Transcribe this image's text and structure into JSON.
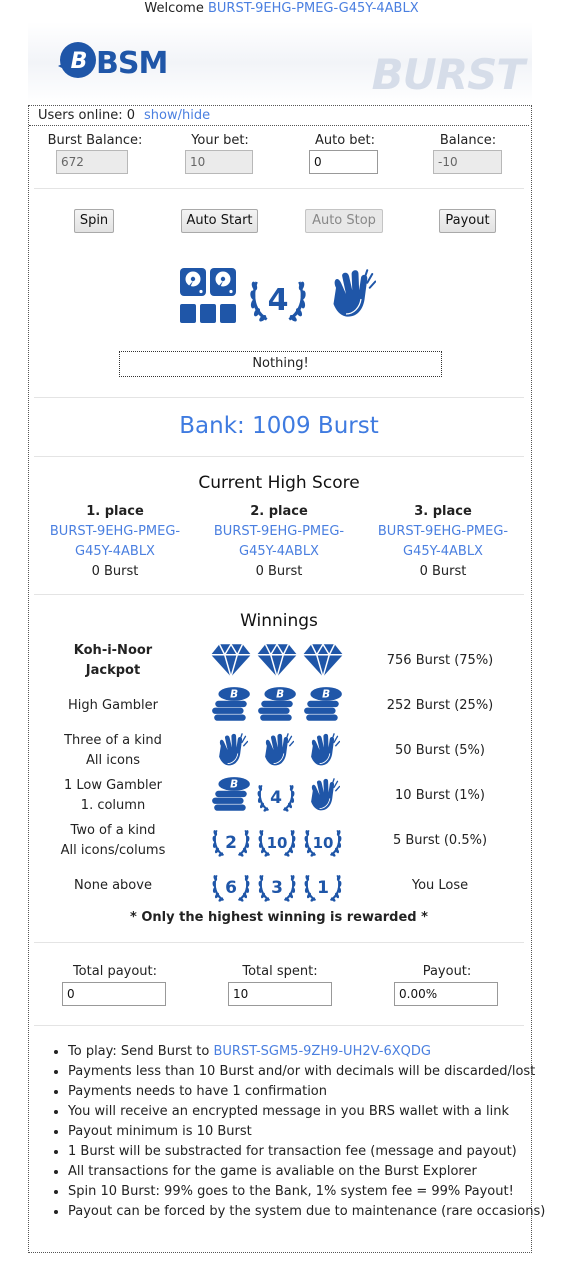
{
  "welcome": {
    "prefix": "Welcome",
    "account": "BURST-9EHG-PMEG-G45Y-4ABLX"
  },
  "header": {
    "logo_text": "BSM",
    "brand_text": "BURST"
  },
  "online": {
    "label": "Users online: 0",
    "toggle": "show/hide"
  },
  "fields": {
    "balance_label": "Burst Balance:",
    "balance_value": "672",
    "bet_label": "Your bet:",
    "bet_value": "10",
    "auto_label": "Auto bet:",
    "auto_value": "0",
    "net_label": "Balance:",
    "net_value": "-10"
  },
  "buttons": {
    "spin": "Spin",
    "auto_start": "Auto Start",
    "auto_stop": "Auto Stop",
    "payout": "Payout"
  },
  "reels": {
    "slot1": "hard-drive-icon",
    "slot2": "number-4-wreath-icon",
    "slot3": "clapping-hands-icon",
    "slot2_number": "4"
  },
  "result": "Nothing!",
  "bank": "Bank: 1009 Burst",
  "highscore": {
    "title": "Current High Score",
    "places": [
      {
        "place": "1. place",
        "acc1": "BURST-9EHG-PMEG-",
        "acc2": "G45Y-4ABLX",
        "amount": "0 Burst"
      },
      {
        "place": "2. place",
        "acc1": "BURST-9EHG-PMEG-",
        "acc2": "G45Y-4ABLX",
        "amount": "0 Burst"
      },
      {
        "place": "3. place",
        "acc1": "BURST-9EHG-PMEG-",
        "acc2": "G45Y-4ABLX",
        "amount": "0 Burst"
      }
    ]
  },
  "winnings": {
    "title": "Winnings",
    "rows": [
      {
        "l1": "Koh-i-Noor",
        "l2": "Jackpot",
        "value": "756 Burst (75%)",
        "icons": [
          "diamond-icon",
          "diamond-icon",
          "diamond-icon"
        ]
      },
      {
        "l1": "High Gambler",
        "l2": "",
        "value": "252 Burst (25%)",
        "icons": [
          "coin-stack-icon",
          "coin-stack-icon",
          "coin-stack-icon"
        ]
      },
      {
        "l1": "Three of a kind",
        "l2": "All icons",
        "value": "50 Burst (5%)",
        "icons": [
          "clapping-hands-icon",
          "clapping-hands-icon",
          "clapping-hands-icon"
        ]
      },
      {
        "l1": "1 Low Gambler",
        "l2": "1. column",
        "value": "10 Burst (1%)",
        "icons": [
          "coin-stack-icon",
          "number-4-wreath-icon",
          "clapping-hands-icon"
        ]
      },
      {
        "l1": "Two of a kind",
        "l2": "All icons/colums",
        "value": "5 Burst (0.5%)",
        "icons": [
          "number-2-wreath-icon",
          "number-10-wreath-icon",
          "number-10-wreath-icon"
        ]
      },
      {
        "l1": "None above",
        "l2": "",
        "value": "You Lose",
        "icons": [
          "number-6-wreath-icon",
          "number-3-wreath-icon",
          "number-1-wreath-icon"
        ]
      }
    ],
    "wreath_numbers": {
      "r3_b": "4",
      "r4_a": "2",
      "r4_b": "10",
      "r4_c": "10",
      "r5_a": "6",
      "r5_b": "3",
      "r5_c": "1"
    },
    "note": "* Only the highest winning is rewarded *"
  },
  "totals": {
    "payout_label": "Total payout:",
    "payout_value": "0",
    "spent_label": "Total spent:",
    "spent_value": "10",
    "pct_label": "Payout:",
    "pct_value": "0.00%"
  },
  "info": {
    "send_prefix": "To play: Send Burst to",
    "send_account": "BURST-SGM5-9ZH9-UH2V-6XQDG",
    "items": [
      "Payments less than 10 Burst and/or with decimals will be discarded/lost",
      "Payments needs to have 1 confirmation",
      "You will receive an encrypted message in you BRS wallet with a link",
      "Payout minimum is 10 Burst",
      "1 Burst will be substracted for transaction fee (message and payout)",
      "All transactions for the game is avaliable on the Burst Explorer",
      "Spin 10 Burst: 99% goes to the Bank, 1% system fee = 99% Payout!",
      "Payout can be forced by the system due to maintenance (rare occasions)"
    ]
  },
  "colors": {
    "icon": "#1f56a8",
    "link": "#4a7fe0",
    "bank": "#3f7be0"
  }
}
